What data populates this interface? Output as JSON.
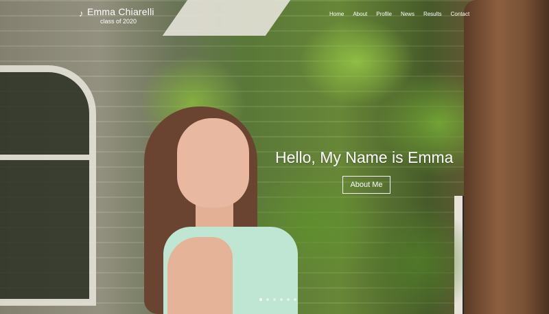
{
  "brand": {
    "name": "Emma Chiarelli",
    "subtitle": "class of 2020",
    "mark_icon": "music-note-icon"
  },
  "nav": {
    "items": [
      "Home",
      "About",
      "Profile",
      "News",
      "Results",
      "Contact"
    ]
  },
  "hero": {
    "title": "Hello, My Name is Emma",
    "button": "About Me",
    "slides": 6,
    "active_slide": 1
  },
  "colors": {
    "text": "#ffffff",
    "button_border": "#ffffff"
  }
}
